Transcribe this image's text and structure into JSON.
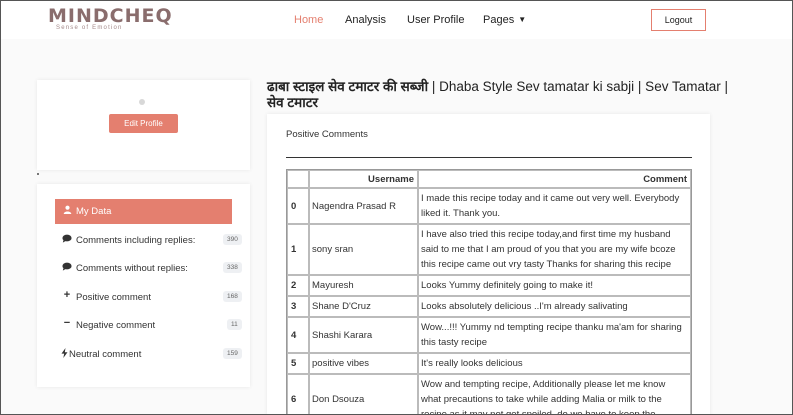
{
  "brand": {
    "logo": "MINDCHEQ",
    "tagline": "Sense of Emotion"
  },
  "nav": {
    "items": [
      "Home",
      "Analysis",
      "User Profile",
      "Pages"
    ],
    "active": "Home",
    "logout": "Logout"
  },
  "profile": {
    "edit_button": "Edit Profile"
  },
  "menu": {
    "items": [
      {
        "label": "My Data",
        "icon": "user-icon",
        "badge": ""
      },
      {
        "label": "Comments including replies:",
        "icon": "comment-icon",
        "badge": "390"
      },
      {
        "label": "Comments without replies:",
        "icon": "comment-icon",
        "badge": "338"
      },
      {
        "label": "Positive comment",
        "icon": "plus-icon",
        "badge": "168"
      },
      {
        "label": "Negative comment",
        "icon": "minus-icon",
        "badge": "11"
      },
      {
        "label": "Neutral comment",
        "icon": "bolt-icon",
        "badge": "159"
      }
    ]
  },
  "main": {
    "title_hindi": "ढाबा स्टाइल सेव टमाटर की सब्जी",
    "title_rest": " | Dhaba Style Sev tamatar ki sabji | Sev Tamatar | ",
    "title_hindi_end": "सेव टमाटर",
    "section_label": "Positive Comments",
    "table": {
      "headers": [
        "",
        "Username",
        "Comment"
      ],
      "rows": [
        {
          "index": "0",
          "username": "Nagendra Prasad R",
          "comment": "I made this recipe today and it came out very well. Everybody liked it. Thank you."
        },
        {
          "index": "1",
          "username": "sony sran",
          "comment": "I have also tried this recipe today,and first time my husband said to me that I am proud of you that you are my wife bcoze this recipe came out vry tasty Thanks for sharing this recipe"
        },
        {
          "index": "2",
          "username": "Mayuresh",
          "comment": "Looks Yummy definitely going to make it!"
        },
        {
          "index": "3",
          "username": "Shane D'Cruz",
          "comment": "Looks absolutely delicious ..I'm already salivating"
        },
        {
          "index": "4",
          "username": "Shashi Karara",
          "comment": "Wow...!!! Yummy nd tempting recipe thanku ma'am for sharing this tasty recipe"
        },
        {
          "index": "5",
          "username": "positive vibes",
          "comment": "It's really looks delicious"
        },
        {
          "index": "6",
          "username": "Don Dsouza",
          "comment": "Wow and tempting recipe, Additionally please let me know what precautions to take while adding Malia or milk to the recipe as it may not get spoiled, do we have to keep the"
        }
      ]
    }
  },
  "colors": {
    "accent": "#e47f6f",
    "logo": "#8a6d6d"
  }
}
